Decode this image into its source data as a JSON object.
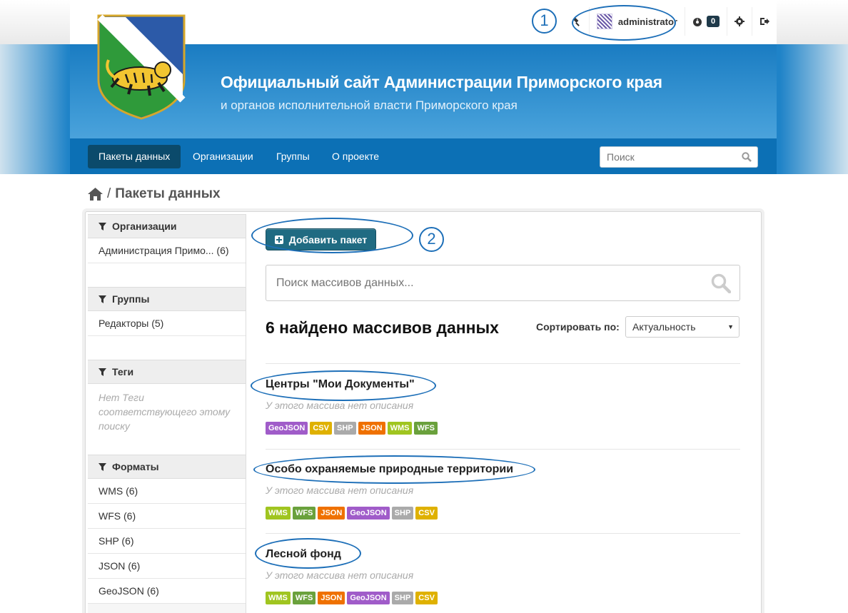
{
  "topbar": {
    "username": "administrator",
    "notifications_count": "0"
  },
  "header": {
    "title": "Официальный сайт Администрации Приморского края",
    "subtitle": "и органов исполнительной власти Приморского края"
  },
  "nav": {
    "items": [
      {
        "label": "Пакеты данных",
        "active": true
      },
      {
        "label": "Организации"
      },
      {
        "label": "Группы"
      },
      {
        "label": "О проекте"
      }
    ],
    "search_placeholder": "Поиск"
  },
  "breadcrumb": {
    "current": "Пакеты данных"
  },
  "sidebar": {
    "organizations": {
      "title": "Организации",
      "items": [
        "Администрация Примо... (6)"
      ]
    },
    "groups": {
      "title": "Группы",
      "items": [
        "Редакторы (5)"
      ]
    },
    "tags": {
      "title": "Теги",
      "empty": "Нет Теги соответствующего этому поиску"
    },
    "formats": {
      "title": "Форматы",
      "items": [
        "WMS (6)",
        "WFS (6)",
        "SHP (6)",
        "JSON (6)",
        "GeoJSON (6)"
      ]
    }
  },
  "content": {
    "add_button": "Добавить пакет",
    "search_placeholder": "Поиск массивов данных...",
    "results_count": "6 найдено массивов данных",
    "sort_label": "Сортировать по:",
    "sort_value": "Актуальность"
  },
  "datasets": [
    {
      "title": "Центры \"Мои Документы\"",
      "description": "У этого массива нет описания",
      "formats": [
        "GeoJSON",
        "CSV",
        "SHP",
        "JSON",
        "WMS",
        "WFS"
      ]
    },
    {
      "title": "Особо охраняемые природные территории",
      "description": "У этого массива нет описания",
      "formats": [
        "WMS",
        "WFS",
        "JSON",
        "GeoJSON",
        "SHP",
        "CSV"
      ]
    },
    {
      "title": "Лесной фонд",
      "description": "У этого массива нет описания",
      "formats": [
        "WMS",
        "WFS",
        "JSON",
        "GeoJSON",
        "SHP",
        "CSV"
      ]
    }
  ],
  "annotations": {
    "marker_1": "1",
    "marker_2": "2"
  },
  "colors": {
    "GeoJSON": "#a05cc9",
    "CSV": "#dfb100",
    "SHP": "#aaaaaa",
    "JSON": "#ef7100",
    "WMS": "#a0c520",
    "WFS": "#6aa13c",
    "annotation": "#1d6fb8"
  }
}
